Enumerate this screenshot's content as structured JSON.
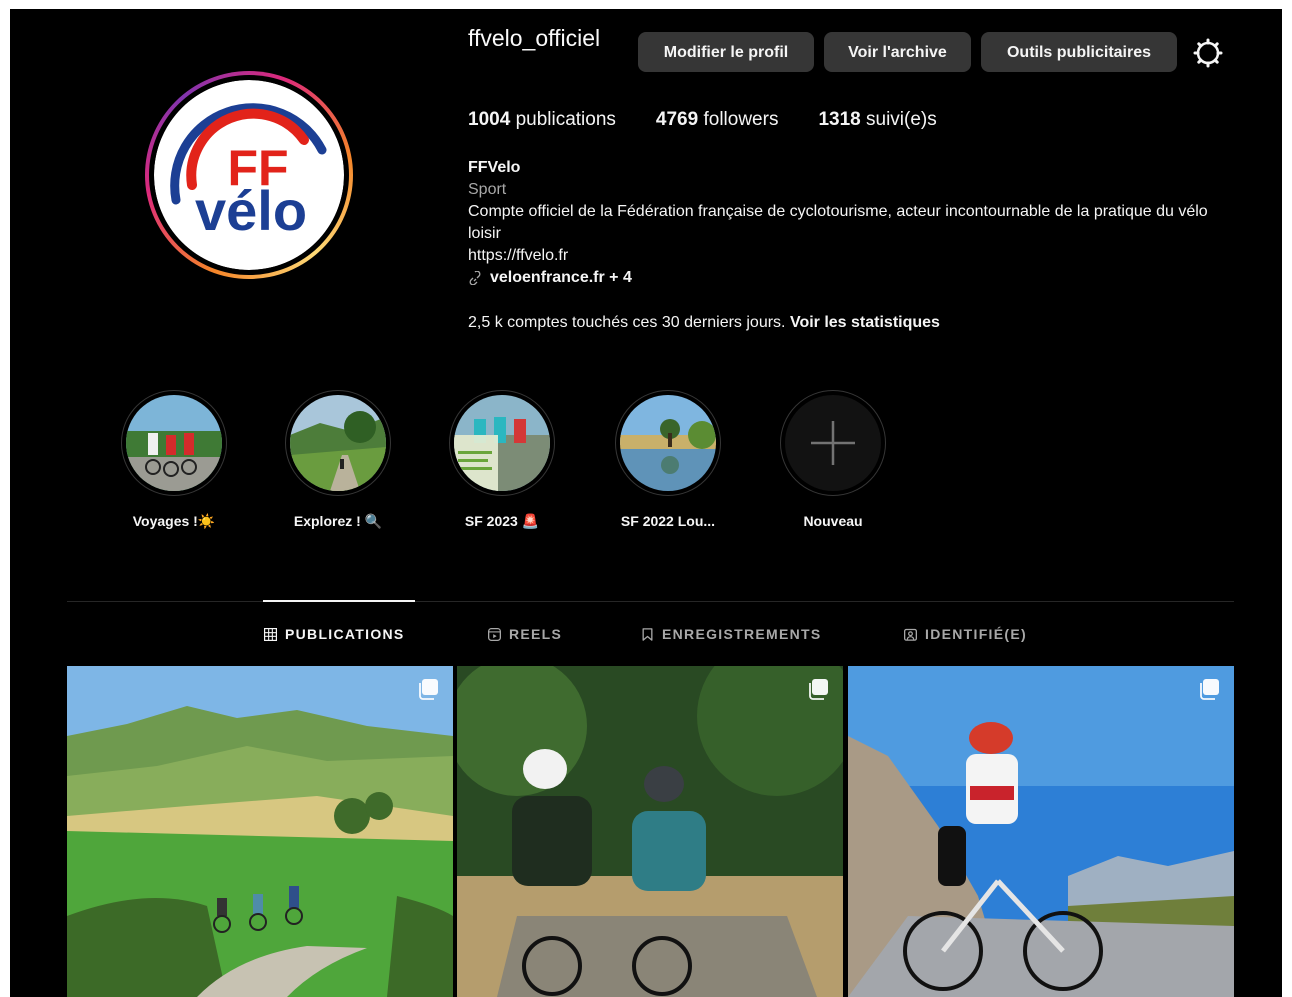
{
  "profile": {
    "username": "ffvelo_officiel",
    "buttons": {
      "edit": "Modifier le profil",
      "archive": "Voir l'archive",
      "ad_tools": "Outils publicitaires"
    },
    "logo_text": {
      "top": "FF",
      "bottom": "vélo"
    }
  },
  "stats": {
    "posts": {
      "count": "1004",
      "label": "publications"
    },
    "followers": {
      "count": "4769",
      "label": "followers"
    },
    "following": {
      "count": "1318",
      "label": "suivi(e)s"
    }
  },
  "bio": {
    "name": "FFVelo",
    "category": "Sport",
    "description": "Compte officiel de la Fédération française de cyclotourisme, acteur incontournable de la pratique du vélo loisir",
    "link1": "https://ffvelo.fr",
    "link2": "veloenfrance.fr + 4"
  },
  "insights": {
    "text": "2,5 k comptes touchés ces 30 derniers jours.",
    "link": "Voir les statistiques"
  },
  "highlights": [
    {
      "label": "Voyages !☀️"
    },
    {
      "label": "Explorez ! 🔍"
    },
    {
      "label": "SF 2023 🚨"
    },
    {
      "label": "SF 2022 Lou..."
    },
    {
      "label": "Nouveau"
    }
  ],
  "tabs": [
    {
      "label": "PUBLICATIONS",
      "icon": "grid-icon",
      "active": true
    },
    {
      "label": "REELS",
      "icon": "reels-icon",
      "active": false
    },
    {
      "label": "ENREGISTREMENTS",
      "icon": "bookmark-icon",
      "active": false
    },
    {
      "label": "IDENTIFIÉ(E)",
      "icon": "tagged-icon",
      "active": false
    }
  ],
  "posts": [
    {
      "icon": "carousel-icon"
    },
    {
      "icon": "carousel-icon"
    },
    {
      "icon": "carousel-icon"
    }
  ],
  "colors": {
    "background": "#000000",
    "button": "#363636",
    "logo_red": "#e2231a",
    "logo_blue": "#1c3f94",
    "divider": "#262626"
  }
}
